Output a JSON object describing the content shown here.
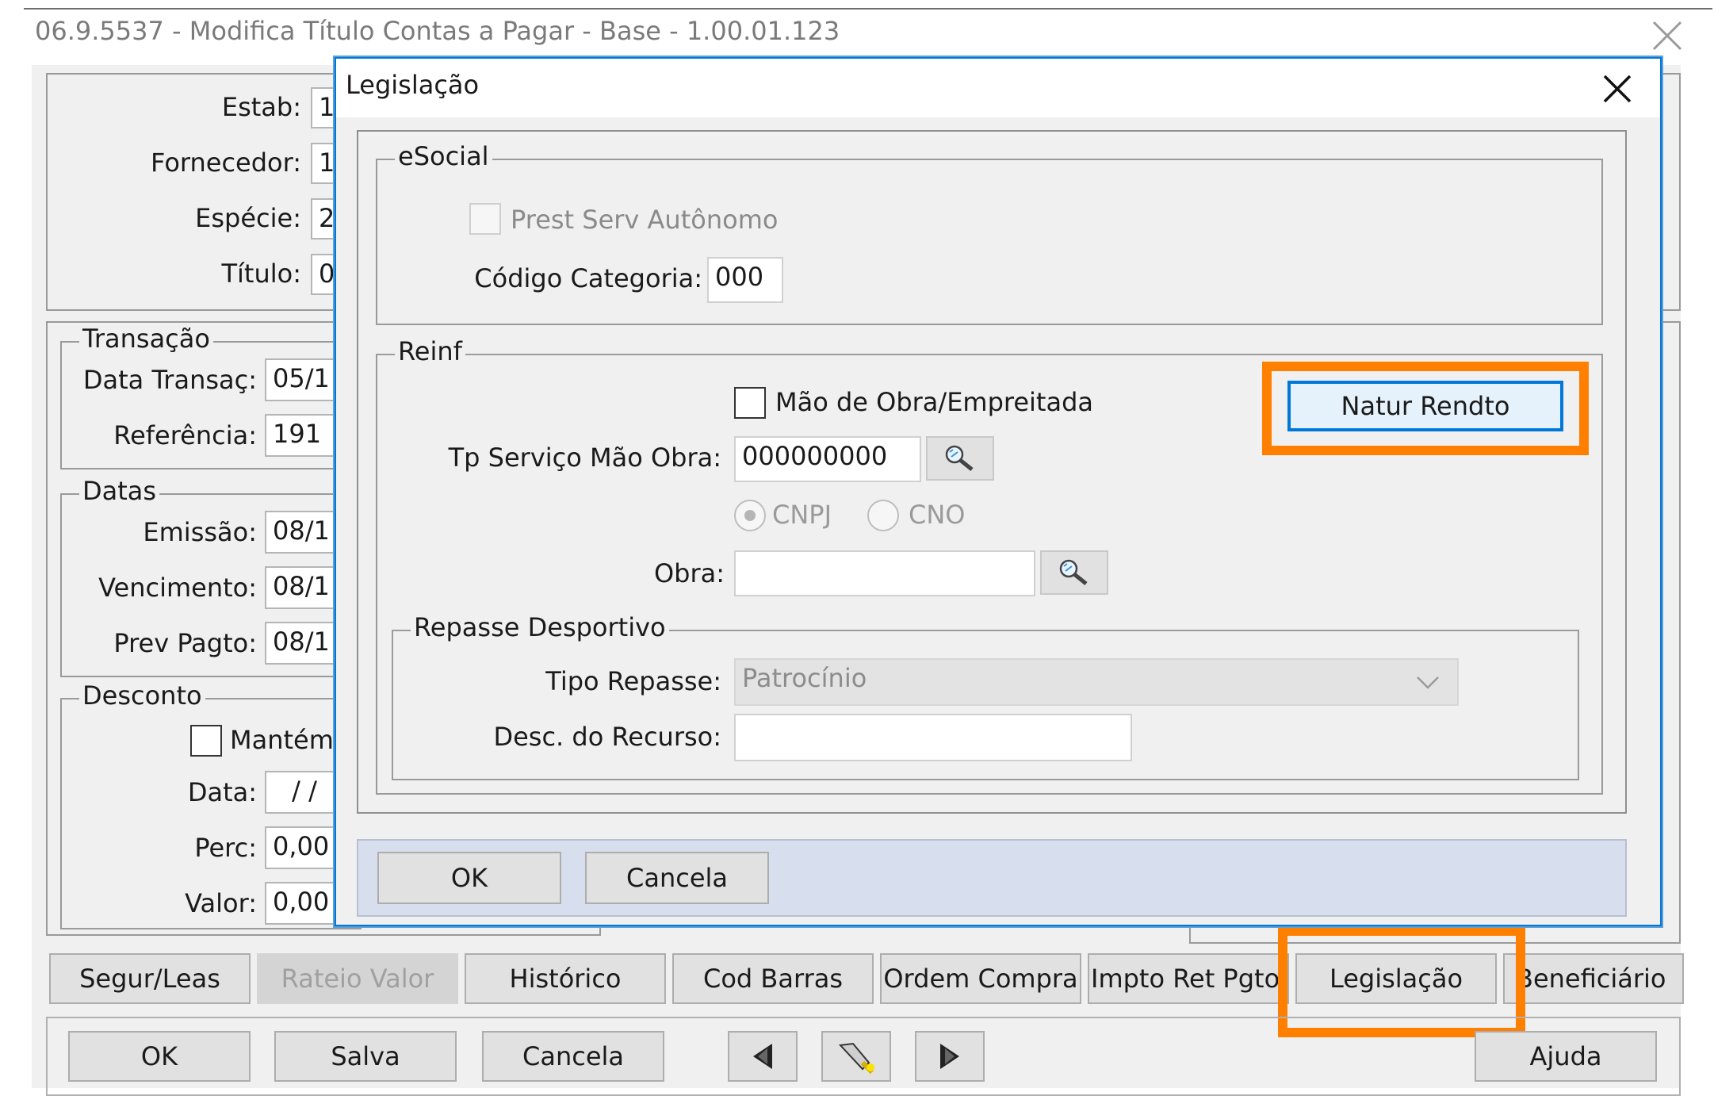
{
  "main_window": {
    "title": "06.9.5537 - Modifica Título Contas a Pagar - Base - 1.00.01.123",
    "fields": {
      "estab_label": "Estab:",
      "estab_value": "1",
      "fornecedor_label": "Fornecedor:",
      "fornecedor_value": "1",
      "especie_label": "Espécie:",
      "especie_value": "2",
      "titulo_label": "Título:",
      "titulo_value": "0"
    },
    "transacao": {
      "title": "Transação",
      "data_label": "Data Transaç:",
      "data_value": "05/1",
      "ref_label": "Referência:",
      "ref_value": "191"
    },
    "datas": {
      "title": "Datas",
      "emissao_label": "Emissão:",
      "emissao_value": "08/1",
      "venc_label": "Vencimento:",
      "venc_value": "08/1",
      "prev_label": "Prev Pagto:",
      "prev_value": "08/1"
    },
    "desconto": {
      "title": "Desconto",
      "mantem_label": "Mantém",
      "data_label": "Data:",
      "data_value": "/ /",
      "perc_label": "Perc:",
      "perc_value": "0,00",
      "valor_label": "Valor:",
      "valor_value": "0,00"
    },
    "tabs": [
      "Segur/Leas",
      "Rateio Valor",
      "Histórico",
      "Cod Barras",
      "Ordem Compra",
      "Impto Ret Pgto",
      "Legislação",
      "Beneficiário"
    ],
    "buttons": {
      "ok": "OK",
      "salva": "Salva",
      "cancela": "Cancela",
      "ajuda": "Ajuda"
    }
  },
  "dialog": {
    "title": "Legislação",
    "esocial": {
      "title": "eSocial",
      "prest_label": "Prest Serv Autônomo",
      "codigo_label": "Código Categoria:",
      "codigo_value": "000"
    },
    "reinf": {
      "title": "Reinf",
      "natur_button": "Natur Rendto",
      "mao_obra_label": "Mão de Obra/Empreitada",
      "tp_servico_label": "Tp Serviço Mão Obra:",
      "tp_servico_value": "000000000",
      "cnpj_label": "CNPJ",
      "cno_label": "CNO",
      "obra_label": "Obra:",
      "obra_value": ""
    },
    "repasse": {
      "title": "Repasse Desportivo",
      "tipo_label": "Tipo Repasse:",
      "tipo_value": "Patrocínio",
      "desc_label": "Desc. do Recurso:",
      "desc_value": ""
    },
    "buttons": {
      "ok": "OK",
      "cancela": "Cancela"
    }
  },
  "colors": {
    "highlight": "#ff8000",
    "focus_border": "#0078d7",
    "window_bg": "#f0f0f0",
    "footer_bg": "#d7deee"
  }
}
